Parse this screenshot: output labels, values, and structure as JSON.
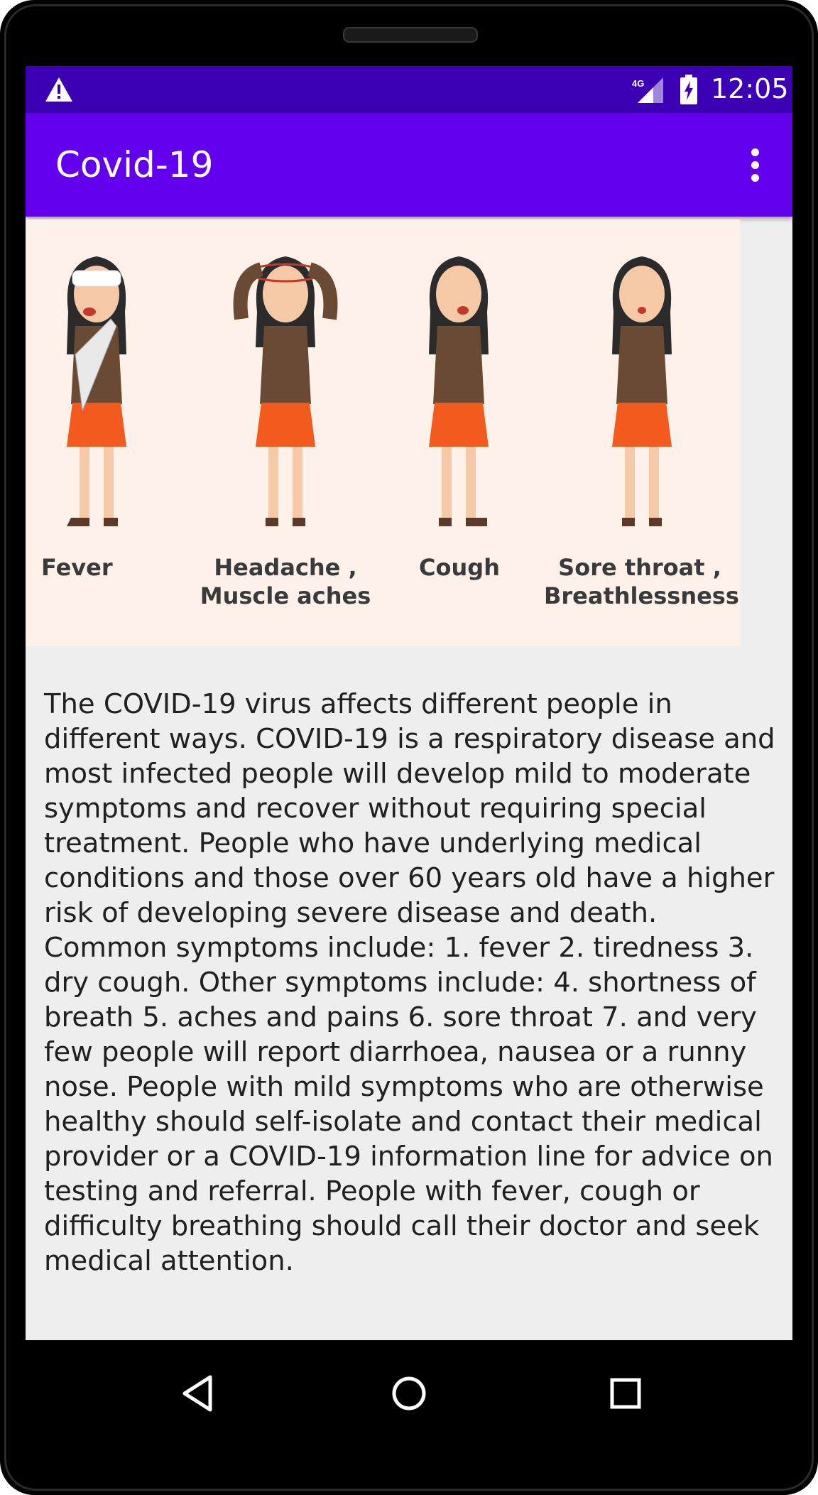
{
  "status_bar": {
    "time": "12:05",
    "network": "4G"
  },
  "app_bar": {
    "title": "Covid-19"
  },
  "illustration": {
    "labels": [
      {
        "line1": "Fever",
        "line2": ""
      },
      {
        "line1": "Headache ,",
        "line2": "Muscle aches"
      },
      {
        "line1": "Cough",
        "line2": ""
      },
      {
        "line1": "Sore throat ,",
        "line2": "Breathlessness"
      }
    ]
  },
  "content": {
    "description": "The COVID-19 virus affects different people in different ways. COVID-19 is a respiratory disease and most infected people will develop mild to moderate symptoms and recover without requiring special treatment. People who have underlying medical conditions and those over 60 years old have a higher risk of developing severe disease and death. Common symptoms include: 1. fever 2. tiredness 3. dry cough. Other symptoms include: 4. shortness of breath 5. aches and pains 6. sore throat 7. and very few people will report diarrhoea, nausea or a runny nose. People with mild symptoms who are otherwise healthy should self-isolate and contact their medical provider or a COVID-19 information line for advice on testing and referral. People with fever, cough or difficulty breathing should call their doctor and seek medical attention."
  },
  "colors": {
    "status_bar": "#3b00b3",
    "app_bar": "#6200ee",
    "illustration_bg": "#fdf1ea",
    "skirt": "#f25a1e",
    "sweater": "#6b4a33"
  },
  "icons": {
    "status": [
      "warning-icon",
      "signal-4g-icon",
      "battery-charging-icon"
    ],
    "app_bar": [
      "overflow-menu-icon"
    ],
    "nav": [
      "back-icon",
      "home-icon",
      "recents-icon"
    ]
  }
}
